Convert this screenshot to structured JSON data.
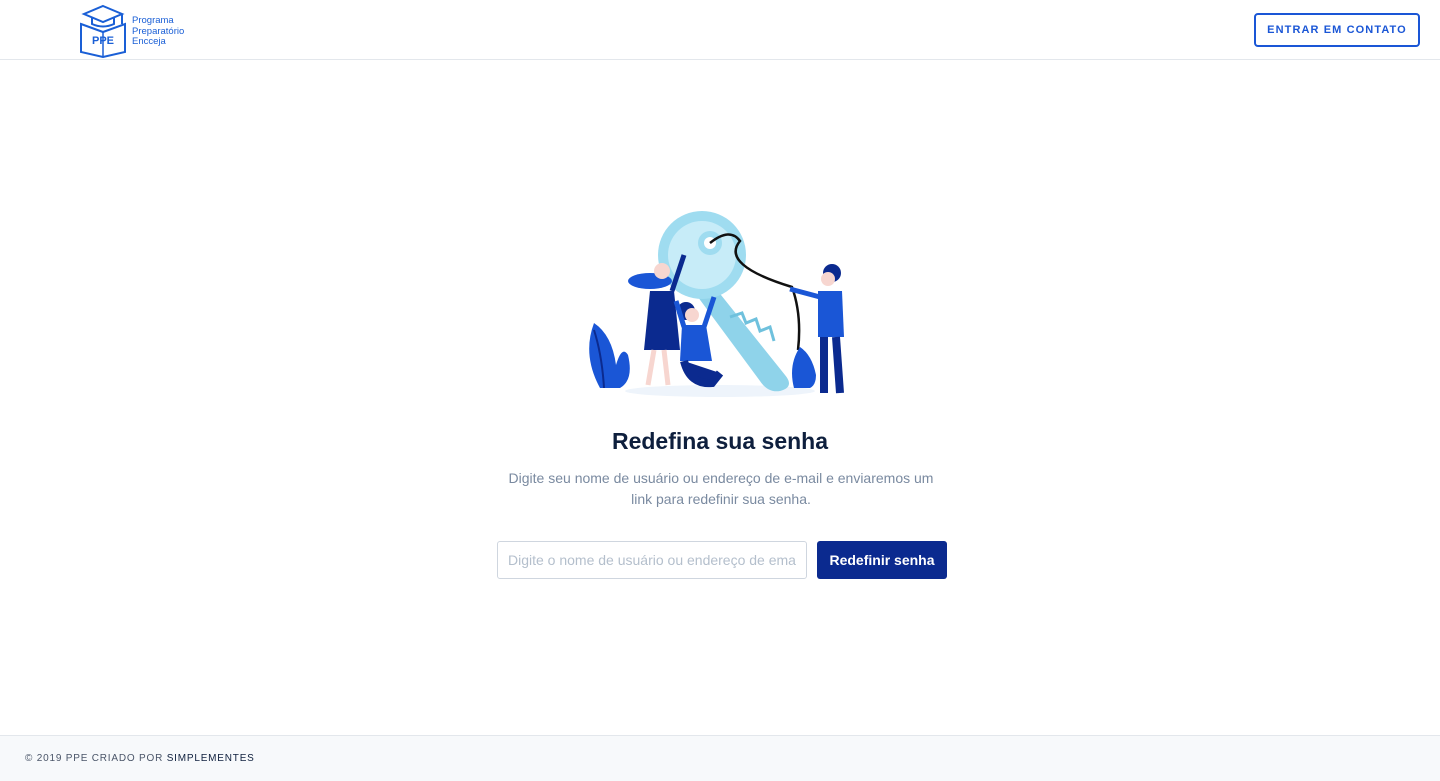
{
  "header": {
    "logo": {
      "mark_text": "PPE",
      "line1": "Programa",
      "line2": "Preparatório",
      "line3": "Encceja"
    },
    "contact_button": "ENTRAR EM CONTATO"
  },
  "main": {
    "illustration_icon": "people-holding-key-illustration",
    "title": "Redefina sua senha",
    "description": "Digite seu nome de usuário ou endereço de e-mail e enviaremos um link para redefinir sua senha.",
    "input": {
      "value": "",
      "placeholder": "Digite o nome de usuário ou endereço de email"
    },
    "submit_button": "Redefinir senha"
  },
  "footer": {
    "prefix": "© 2019 PPE CRIADO POR ",
    "brand": "SIMPLEMENTES"
  },
  "colors": {
    "primary": "#0b2a8f",
    "accent": "#1a56d6",
    "key": "#8fd3ea",
    "title": "#0e1f3d",
    "muted": "#7a8aa0"
  }
}
